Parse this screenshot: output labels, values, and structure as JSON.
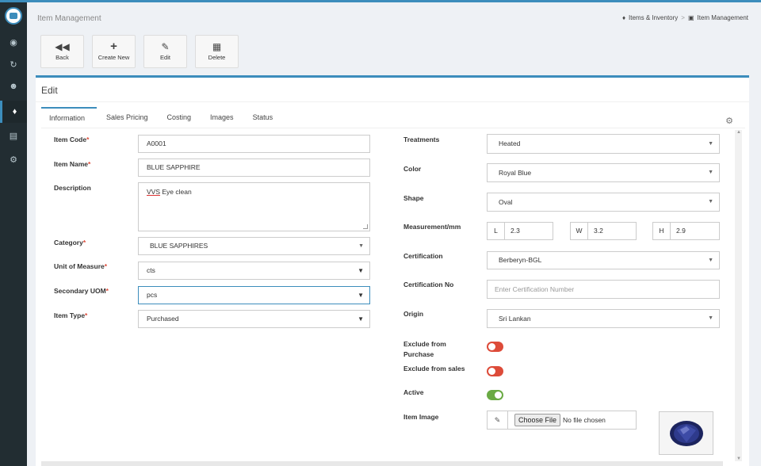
{
  "header": {
    "title": "Item Management",
    "breadcrumb": [
      "Items & Inventory",
      "Item Management"
    ],
    "breadcrumb_sep": ">"
  },
  "sidebar": {
    "icons": [
      "dashboard-icon",
      "refresh-icon",
      "users-icon",
      "cubes-icon",
      "bar-chart-icon",
      "settings-icon"
    ],
    "active_index": 3
  },
  "toolbar": {
    "back_label": "Back",
    "create_label": "Create New",
    "edit_label": "Edit",
    "delete_label": "Delete"
  },
  "panel": {
    "title": "Edit",
    "tabs": [
      {
        "label": "Information",
        "active": true
      },
      {
        "label": "Sales Pricing",
        "active": false
      },
      {
        "label": "Costing",
        "active": false
      },
      {
        "label": "Images",
        "active": false
      },
      {
        "label": "Status",
        "active": false
      }
    ]
  },
  "left_form": {
    "item_code": {
      "label": "Item Code",
      "required": "*",
      "value": "A0001"
    },
    "item_name": {
      "label": "Item Name",
      "required": "*",
      "value": "BLUE SAPPHIRE"
    },
    "description": {
      "label": "Description",
      "value_underlined": "VVS",
      "value_rest": " Eye clean"
    },
    "category": {
      "label": "Category",
      "required": "*",
      "value": "BLUE SAPPHIRES"
    },
    "uom": {
      "label": "Unit of Measure",
      "required": "*",
      "value": "cts"
    },
    "secondary_uom": {
      "label": "Secondary UOM",
      "required": "*",
      "value": "pcs"
    },
    "item_type": {
      "label": "Item Type",
      "required": "*",
      "value": "Purchased"
    }
  },
  "right_form": {
    "treatments": {
      "label": "Treatments",
      "value": "Heated"
    },
    "color": {
      "label": "Color",
      "value": "Royal Blue"
    },
    "shape": {
      "label": "Shape",
      "value": "Oval"
    },
    "measurement": {
      "label": "Measurement/mm",
      "l": {
        "addon": "L",
        "value": "2.3"
      },
      "w": {
        "addon": "W",
        "value": "3.2"
      },
      "h": {
        "addon": "H",
        "value": "2.9"
      }
    },
    "certification": {
      "label": "Certification",
      "value": "Berberyn-BGL"
    },
    "certification_no": {
      "label": "Certification No",
      "placeholder": "Enter Certification Number"
    },
    "origin": {
      "label": "Origin",
      "value": "Sri Lankan"
    },
    "exclude_purchase": {
      "label_line1": "Exclude from",
      "label_line2": "Purchase",
      "state": "off"
    },
    "exclude_sales": {
      "label": "Exclude from sales",
      "state": "off"
    },
    "active": {
      "label": "Active",
      "state": "on"
    },
    "item_image": {
      "label": "Item Image",
      "button": "Choose File",
      "status": "No file chosen"
    }
  },
  "colors": {
    "accent": "#3c8dbc",
    "sidebar": "#222d32",
    "toggle_off": "#dd4b39",
    "toggle_on": "#6aaa44",
    "gem": "#2e3a8c"
  }
}
